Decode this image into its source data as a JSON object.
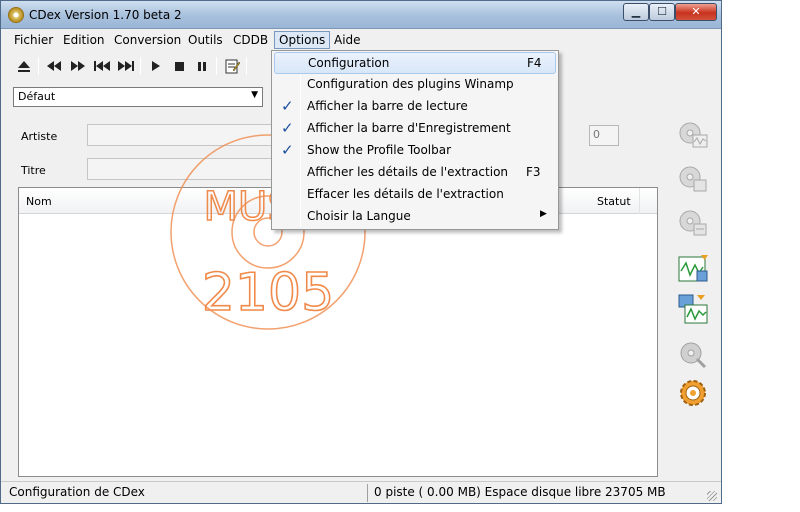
{
  "window": {
    "title": "CDex Version 1.70 beta 2",
    "controls": {
      "minimize": "▁",
      "maximize": "☐",
      "close": "✕"
    }
  },
  "menubar": {
    "items": [
      "Fichier",
      "Edition",
      "Conversion",
      "Outils",
      "CDDB",
      "Options",
      "Aide"
    ],
    "open": "Options"
  },
  "toolbar": {
    "buttons": [
      "eject-icon",
      "rewind-icon",
      "fast-forward-icon",
      "previous-track-icon",
      "next-track-icon",
      "play-icon",
      "stop-icon",
      "pause-icon",
      "edit-icon"
    ]
  },
  "profile": {
    "selected": "Défaut"
  },
  "form": {
    "artist_label": "Artiste",
    "title_label": "Titre",
    "track_count_value": "0"
  },
  "tracklist": {
    "columns": [
      "Nom",
      "Statut"
    ],
    "rows": []
  },
  "side_tools": [
    "extract-wav-icon",
    "extract-mp3-icon",
    "extract-partial-icon",
    "convert-wav-icon",
    "convert-mp3-icon",
    "record-icon",
    "configuration-icon"
  ],
  "options_menu": {
    "items": [
      {
        "label": "Configuration",
        "shortcut": "F4",
        "checked": false,
        "highlighted": true,
        "submenu": false
      },
      {
        "label": "Configuration des plugins Winamp",
        "shortcut": "",
        "checked": false,
        "highlighted": false,
        "submenu": false
      },
      {
        "label": "Afficher la barre de lecture",
        "shortcut": "",
        "checked": true,
        "highlighted": false,
        "submenu": false
      },
      {
        "label": "Afficher la barre d'Enregistrement",
        "shortcut": "",
        "checked": true,
        "highlighted": false,
        "submenu": false
      },
      {
        "label": "Show the Profile Toolbar",
        "shortcut": "",
        "checked": true,
        "highlighted": false,
        "submenu": false
      },
      {
        "label": "Afficher les détails de l'extraction",
        "shortcut": "F3",
        "checked": false,
        "highlighted": false,
        "submenu": false
      },
      {
        "label": "Effacer les détails de l'extraction",
        "shortcut": "",
        "checked": false,
        "highlighted": false,
        "submenu": false
      },
      {
        "label": "Choisir la Langue",
        "shortcut": "",
        "checked": false,
        "highlighted": false,
        "submenu": true
      }
    ]
  },
  "statusbar": {
    "left": "Configuration de CDex",
    "right": "0 piste ( 0.00 MB) Espace disque libre 23705 MB"
  },
  "watermark": {
    "line1": "MUSIC",
    "line2": "2105",
    "color": "#f08a4a"
  },
  "colors": {
    "check": "#1c4ea0",
    "highlight": "#d8e7f8"
  }
}
